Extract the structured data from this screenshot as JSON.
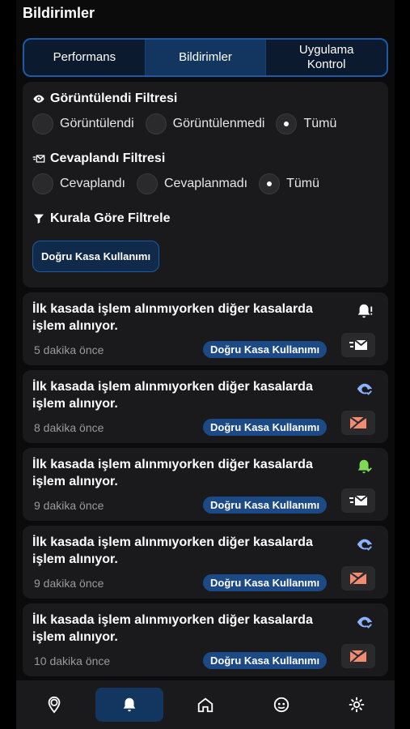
{
  "header": {
    "title": "Bildirimler"
  },
  "tabs": [
    {
      "label": "Performans",
      "active": false
    },
    {
      "label": "Bildirimler",
      "active": true
    },
    {
      "label": "Uygulama Kontrol",
      "active": false
    }
  ],
  "filters": {
    "viewed": {
      "title": "Görüntülendi Filtresi",
      "options": [
        "Görüntülendi",
        "Görüntülenmedi",
        "Tümü"
      ],
      "selected": "Tümü"
    },
    "answered": {
      "title": "Cevaplandı Filtresi",
      "options": [
        "Cevaplandı",
        "Cevaplanmadı",
        "Tümü"
      ],
      "selected": "Tümü"
    },
    "rule": {
      "title": "Kurala Göre Filtrele",
      "chip": "Doğru Kasa Kullanımı"
    }
  },
  "notifications": [
    {
      "message": "İlk kasada işlem alınmıyorken diğer kasalarda işlem alınıyor.",
      "time": "5 dakika önce",
      "tag": "Doğru Kasa Kullanımı",
      "status_icon": "bell-alert-icon",
      "action_icon": "message-icon"
    },
    {
      "message": "İlk kasada işlem alınmıyorken diğer kasalarda işlem alınıyor.",
      "time": "8 dakika önce",
      "tag": "Doğru Kasa Kullanımı",
      "status_icon": "eye-check-icon",
      "action_icon": "message-off-icon"
    },
    {
      "message": "İlk kasada işlem alınmıyorken diğer kasalarda işlem alınıyor.",
      "time": "9 dakika önce",
      "tag": "Doğru Kasa Kullanımı",
      "status_icon": "bell-check-icon",
      "action_icon": "message-icon"
    },
    {
      "message": "İlk kasada işlem alınmıyorken diğer kasalarda işlem alınıyor.",
      "time": "9 dakika önce",
      "tag": "Doğru Kasa Kullanımı",
      "status_icon": "eye-check-icon",
      "action_icon": "message-off-icon"
    },
    {
      "message": "İlk kasada işlem alınmıyorken diğer kasalarda işlem alınıyor.",
      "time": "10 dakika önce",
      "tag": "Doğru Kasa Kullanımı",
      "status_icon": "eye-check-icon",
      "action_icon": "message-off-icon"
    }
  ],
  "bottom_nav": [
    {
      "icon": "location-pin-icon",
      "active": false
    },
    {
      "icon": "bell-icon",
      "active": true
    },
    {
      "icon": "home-icon",
      "active": false
    },
    {
      "icon": "face-icon",
      "active": false
    },
    {
      "icon": "settings-icon",
      "active": false
    }
  ],
  "colors": {
    "accent": "#1c5aa8",
    "chip": "#1c4a86",
    "eye": "#8ab4ff",
    "bell_ok": "#7ed957",
    "message_off": "#f48a70"
  }
}
